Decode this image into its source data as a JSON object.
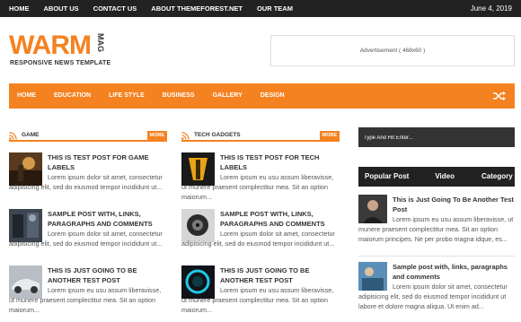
{
  "topbar": {
    "nav": [
      "HOME",
      "ABOUT US",
      "CONTACT US",
      "ABOUT THEMEFOREST.NET",
      "OUR TEAM"
    ],
    "date": "June 4, 2019"
  },
  "logo": {
    "main": "WARM",
    "side": "MAG",
    "sub": "RESPONSIVE NEWS TEMPLATE"
  },
  "ad": {
    "text": "Advertisement ( 468x60 )"
  },
  "mainnav": {
    "items": [
      "HOME",
      "EDUCATION",
      "LIFE STYLE",
      "BUSINESS",
      "GALLERY",
      "DESIGN"
    ]
  },
  "columns": [
    {
      "title": "GAME",
      "more": "MORE",
      "posts": [
        {
          "title": "THIS IS TEST POST FOR GAME LABELS",
          "excerpt": "Lorem ipsum dolor sit amet, consectetur adipisicing elit, sed do eiusmod tempor incididunt ut..."
        },
        {
          "title": "SAMPLE POST WITH, LINKS, PARAGRAPHS AND COMMENTS",
          "excerpt": "Lorem ipsum dolor sit amet, consectetur adipisicing elit, sed do eiusmod tempor incididunt ut..."
        },
        {
          "title": "THIS IS JUST GOING TO BE ANOTHER TEST POST",
          "excerpt": "Lorem ipsum eu usu assum liberavisse, ut munere praesent complectitur mea. Sit an option maiorum..."
        }
      ]
    },
    {
      "title": "TECH GADGETS",
      "more": "MORE",
      "posts": [
        {
          "title": "THIS IS TEST POST FOR TECH LABELS",
          "excerpt": "Lorem ipsum eu usu assum liberavisse, ut munere praesent complectitur mea. Sit an option maiorum..."
        },
        {
          "title": "SAMPLE POST WITH, LINKS, PARAGRAPHS AND COMMENTS",
          "excerpt": "Lorem ipsum dolor sit amet, consectetur adipisicing elit, sed do eiusmod tempor incididunt ut..."
        },
        {
          "title": "THIS IS JUST GOING TO BE ANOTHER TEST POST",
          "excerpt": "Lorem ipsum eu usu assum liberavisse, ut munere praesent complectitur mea. Sit an option maiorum..."
        }
      ]
    }
  ],
  "sidebar": {
    "search_placeholder": "Type And Hit Enter...",
    "tabs": [
      "Popular Post",
      "Video",
      "Category"
    ],
    "posts": [
      {
        "title": "This is Just Going To Be Another Test Post",
        "excerpt": "Lorem ipsum eu usu assum liberavisse, ut munere praesent complectitur mea. Sit an option maiorum principes. Ne per probo magna idque, es..."
      },
      {
        "title": "Sample post with, links, paragraphs and comments",
        "excerpt": "Lorem ipsum dolor sit amet, consectetur adipisicing elit, sed do eiusmod tempor incididunt ut labore et dolore magna aliqua. Ut enim ad..."
      }
    ]
  },
  "colors": {
    "accent": "#f58220",
    "dark": "#222222"
  }
}
